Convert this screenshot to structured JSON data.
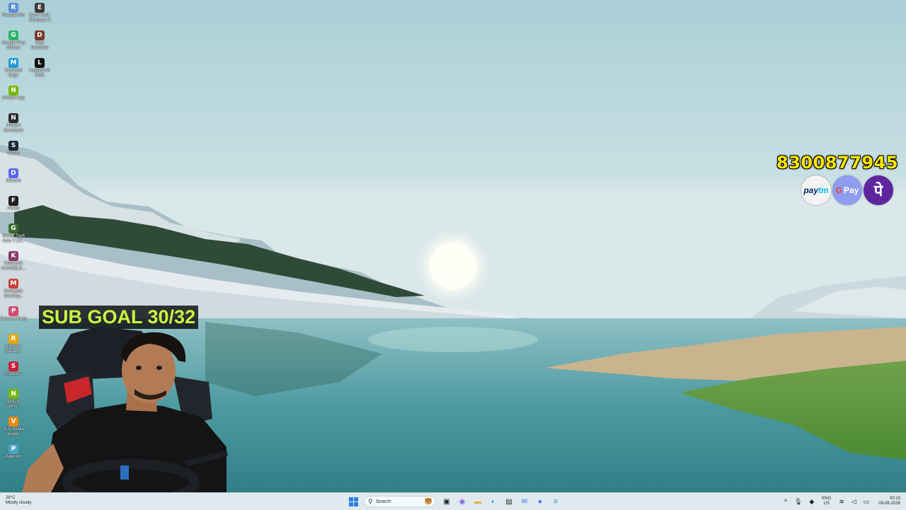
{
  "desktop": {
    "icons": [
      {
        "label": "Recycle Bin",
        "icon": "recycle-bin-icon",
        "color": "#5a8fd6"
      },
      {
        "label": "Euro Truck Simulator 2",
        "icon": "euro-truck-icon",
        "color": "#3a3a3a"
      },
      {
        "label": "Google Play Games",
        "icon": "google-play-games-icon",
        "color": "#2fb36a"
      },
      {
        "label": "Dirty Business",
        "icon": "dirty-business-icon",
        "color": "#7a3b2e"
      },
      {
        "label": "Microsoft Edge",
        "icon": "edge-icon",
        "color": "#1f9bd8"
      },
      {
        "label": "Logitech G HUB",
        "icon": "logitech-ghub-icon",
        "color": "#111111"
      },
      {
        "label": "NVIDIA App",
        "icon": "nvidia-app-icon",
        "color": "#76b900"
      },
      {
        "label": "NVIDIA Broadcast",
        "icon": "nvidia-broadcast-icon",
        "color": "#2b2b2b"
      },
      {
        "label": "Steam",
        "icon": "steam-icon",
        "color": "#1b2838"
      },
      {
        "label": "Discord",
        "icon": "discord-icon",
        "color": "#5865f2"
      },
      {
        "label": "FiveM",
        "icon": "fivem-icon",
        "color": "#1d1d1d"
      },
      {
        "label": "Grand Theft Auto V Le...",
        "icon": "gta-v-icon",
        "color": "#3c6b2f"
      },
      {
        "label": "KMCCHA CHAMELE...",
        "icon": "kmccha-icon",
        "color": "#8a3a6a"
      },
      {
        "label": "Monopoly Banking...",
        "icon": "monopoly-icon",
        "color": "#c8423a"
      },
      {
        "label": "Pummel Party",
        "icon": "pummel-party-icon",
        "color": "#d04b6e"
      },
      {
        "label": "Rockstar Games...",
        "icon": "rockstar-icon",
        "color": "#e6a800"
      },
      {
        "label": "Stacher7",
        "icon": "stacher-icon",
        "color": "#c8203a"
      },
      {
        "label": "NVIDIA GeFor...",
        "icon": "nvidia-geforce-icon",
        "color": "#76b900"
      },
      {
        "label": "VLC media player",
        "icon": "vlc-icon",
        "color": "#f08a00"
      },
      {
        "label": "Palworld",
        "icon": "palworld-icon",
        "color": "#4aa3c8"
      }
    ]
  },
  "overlay": {
    "phone": "8300877945",
    "payments": [
      {
        "name": "Paytm",
        "icon": "paytm-icon"
      },
      {
        "name": "G Pay",
        "icon": "gpay-icon"
      },
      {
        "name": "PhonePe",
        "icon": "phonepe-icon"
      }
    ],
    "sub_goal": "SUB GOAL 30/32"
  },
  "taskbar": {
    "weather_temp": "28°C",
    "weather_desc": "Mostly cloudy",
    "search_placeholder": "Search",
    "apps": [
      {
        "name": "file-explorer",
        "icon": "folder-icon"
      },
      {
        "name": "edge",
        "icon": "edge-icon"
      },
      {
        "name": "store",
        "icon": "store-icon"
      },
      {
        "name": "mail",
        "icon": "mail-icon"
      },
      {
        "name": "discord",
        "icon": "discord-icon"
      },
      {
        "name": "notepad",
        "icon": "notepad-icon"
      }
    ],
    "lang_top": "ENG",
    "lang_bottom": "US",
    "time": "00:10",
    "date": "09-08-2026"
  },
  "colors": {
    "phone_text": "#ffe600",
    "subgoal_text": "#c8f542",
    "taskbar_bg": "#dfe9ee"
  }
}
